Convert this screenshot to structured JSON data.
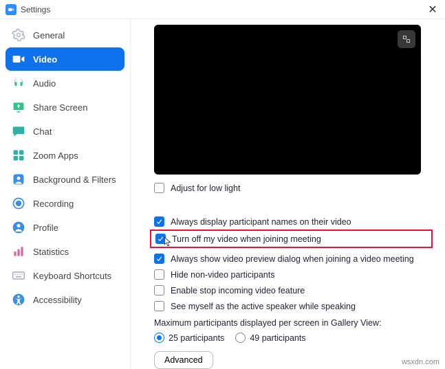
{
  "window": {
    "title": "Settings"
  },
  "sidebar": {
    "items": [
      {
        "label": "General"
      },
      {
        "label": "Video"
      },
      {
        "label": "Audio"
      },
      {
        "label": "Share Screen"
      },
      {
        "label": "Chat"
      },
      {
        "label": "Zoom Apps"
      },
      {
        "label": "Background & Filters"
      },
      {
        "label": "Recording"
      },
      {
        "label": "Profile"
      },
      {
        "label": "Statistics"
      },
      {
        "label": "Keyboard Shortcuts"
      },
      {
        "label": "Accessibility"
      }
    ]
  },
  "video": {
    "adjust_low_light": "Adjust for low light",
    "always_display_names": "Always display participant names on their video",
    "turn_off_video": "Turn off my video when joining meeting",
    "always_preview": "Always show video preview dialog when joining a video meeting",
    "hide_nonvideo": "Hide non-video participants",
    "enable_stop_incoming": "Enable stop incoming video feature",
    "see_myself_active": "See myself as the active speaker while speaking",
    "gallery_label": "Maximum participants displayed per screen in Gallery View:",
    "radio_25": "25 participants",
    "radio_49": "49 participants",
    "advanced": "Advanced"
  },
  "watermark": "wsxdn.com"
}
